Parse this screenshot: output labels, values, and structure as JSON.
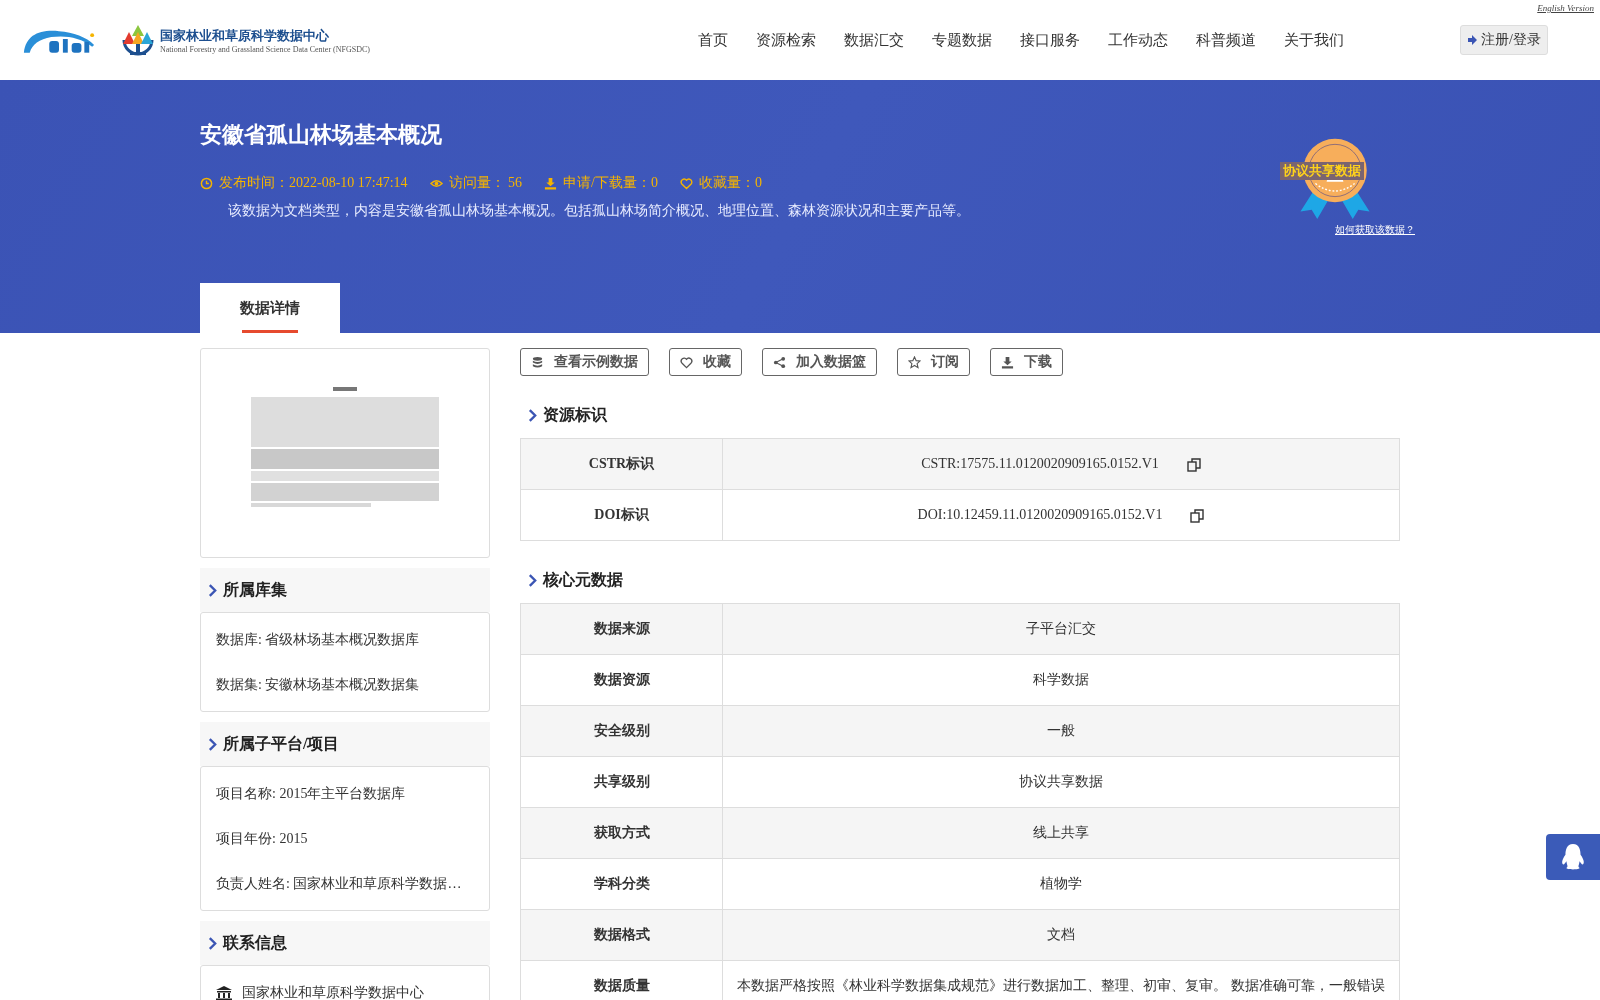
{
  "header": {
    "english_link": "English Version",
    "logo_text": "国家林业和草原科学数据中心",
    "logo_subtitle": "National Forestry and Grassland Science Data Center (NFGSDC)",
    "nav": [
      "首页",
      "资源检索",
      "数据汇交",
      "专题数据",
      "接口服务",
      "工作动态",
      "科普频道",
      "关于我们"
    ],
    "login_button": "注册/登录"
  },
  "banner": {
    "title": "安徽省孤山林场基本概况",
    "meta": [
      {
        "kind": "time",
        "text": "发布时间：2022-08-10 17:47:14"
      },
      {
        "kind": "views",
        "text": "访问量： 56"
      },
      {
        "kind": "downloads",
        "text": "申请/下载量：0"
      },
      {
        "kind": "favorites",
        "text": "收藏量：0"
      }
    ],
    "description": "该数据为文档类型，内容是安徽省孤山林场基本概况。包括孤山林场简介概况、地理位置、森林资源状况和主要产品等。",
    "badge": {
      "label": "协议共享数据",
      "link": "如何获取该数据？"
    },
    "tabs": [
      {
        "label": "数据详情",
        "selected": true
      }
    ]
  },
  "sidebar": [
    {
      "heading": "所属库集",
      "items": [
        {
          "kind": "text",
          "text": "数据库: 省级林场基本概况数据库"
        },
        {
          "kind": "text",
          "text": "数据集: 安徽林场基本概况数据集"
        }
      ]
    },
    {
      "heading": "所属子平台/项目",
      "items": [
        {
          "kind": "text",
          "text": "项目名称: 2015年主平台数据库"
        },
        {
          "kind": "text",
          "text": "项目年份: 2015"
        },
        {
          "kind": "text",
          "text": "负责人姓名: 国家林业和草原科学数据…"
        }
      ]
    },
    {
      "heading": "联系信息",
      "items": [
        {
          "kind": "institution",
          "text": "国家林业和草原科学数据中心"
        }
      ]
    }
  ],
  "actions": [
    {
      "kind": "sample",
      "label": "查看示例数据"
    },
    {
      "kind": "favorite",
      "label": "收藏"
    },
    {
      "kind": "basket",
      "label": "加入数据篮"
    },
    {
      "kind": "subscribe",
      "label": "订阅"
    },
    {
      "kind": "download",
      "label": "下载"
    }
  ],
  "resource_id": {
    "heading": "资源标识",
    "rows": [
      {
        "label": "CSTR标识",
        "value": "CSTR:17575.11.0120020909165.0152.V1"
      },
      {
        "label": "DOI标识",
        "value": "DOI:10.12459.11.0120020909165.0152.V1"
      }
    ]
  },
  "core_metadata": {
    "heading": "核心元数据",
    "rows": [
      {
        "label": "数据来源",
        "value": "子平台汇交"
      },
      {
        "label": "数据资源",
        "value": "科学数据"
      },
      {
        "label": "安全级别",
        "value": "一般"
      },
      {
        "label": "共享级别",
        "value": "协议共享数据"
      },
      {
        "label": "获取方式",
        "value": "线上共享"
      },
      {
        "label": "学科分类",
        "value": "植物学"
      },
      {
        "label": "数据格式",
        "value": "文档"
      },
      {
        "label": "数据质量",
        "value": "本数据严格按照《林业科学数据集成规范》进行数据加工、整理、初审、复审。 数据准确可靠，一般错误"
      }
    ]
  }
}
